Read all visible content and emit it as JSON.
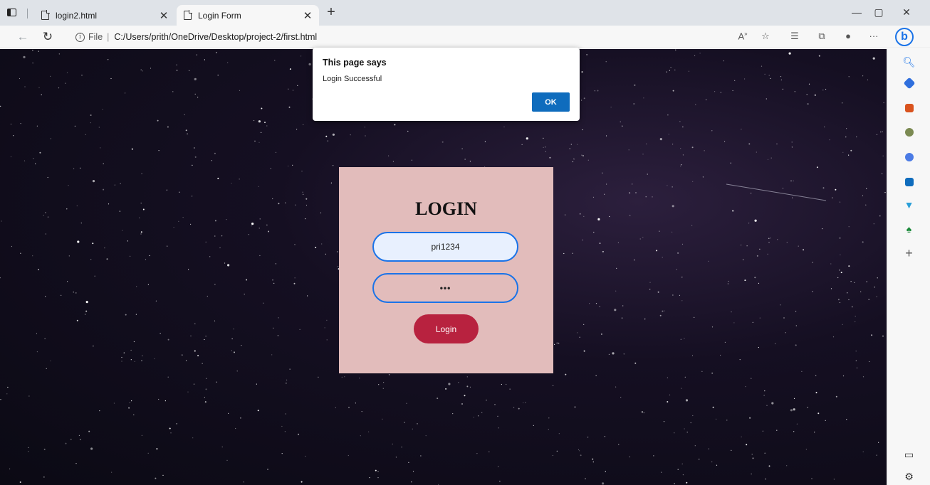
{
  "browser": {
    "tabs": [
      {
        "title": "login2.html",
        "active": false
      },
      {
        "title": "Login Form",
        "active": true
      }
    ],
    "address": {
      "file_label": "File",
      "separator": "|",
      "url": "C:/Users/prith/OneDrive/Desktop/project-2/first.html"
    },
    "toolbar_icons": [
      "back-icon",
      "refresh-icon",
      "read-aloud-icon",
      "favorite-icon",
      "favorites-list-icon",
      "collections-icon",
      "profile-icon",
      "more-icon",
      "bing-icon"
    ],
    "more_label": "···"
  },
  "dialog": {
    "title": "This page says",
    "message": "Login Successful",
    "ok_label": "OK"
  },
  "login_form": {
    "title": "LOGIN",
    "username_value": "pri1234",
    "password_value": "•••",
    "button_label": "Login"
  },
  "sidebar": {
    "icons": [
      "search-icon",
      "shopping-tag-icon",
      "tools-briefcase-icon",
      "games-icon",
      "office-icon",
      "outlook-icon",
      "drop-icon",
      "tree-icon",
      "add-icon",
      "split-screen-icon",
      "settings-icon"
    ],
    "add_label": "+"
  },
  "colors": {
    "card_background": "#e2bcbb",
    "field_border": "#1a73e8",
    "login_button": "#b8223f",
    "ok_button": "#0f6cbd"
  }
}
